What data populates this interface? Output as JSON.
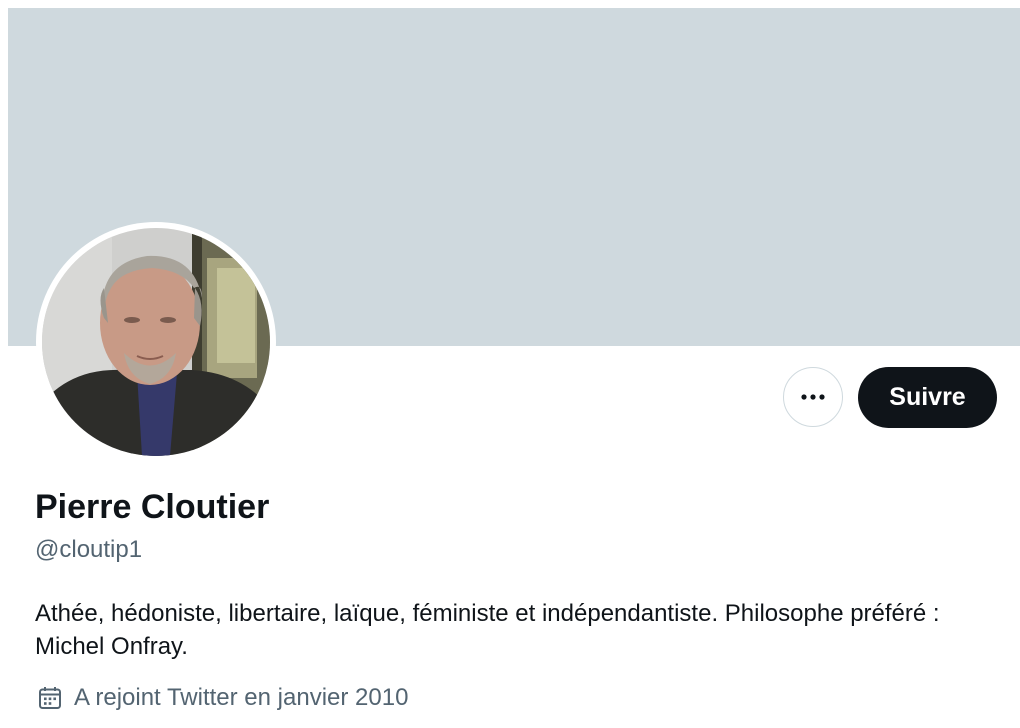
{
  "profile": {
    "name": "Pierre Cloutier",
    "handle": "@cloutip1",
    "bio": "Athée, hédoniste, libertaire, laïque, féministe et indépendantiste. Philosophe préféré : Michel Onfray.",
    "joined": "A rejoint Twitter en janvier 2010"
  },
  "actions": {
    "follow_label": "Suivre",
    "more_icon": "more-horizontal-icon"
  },
  "icons": {
    "joined_icon": "calendar-icon"
  },
  "colors": {
    "banner": "#cfd9de",
    "primary_text": "#0f1419",
    "secondary_text": "#536471",
    "follow_button_bg": "#0f1419",
    "follow_button_text": "#ffffff",
    "border": "#cfd9de"
  }
}
